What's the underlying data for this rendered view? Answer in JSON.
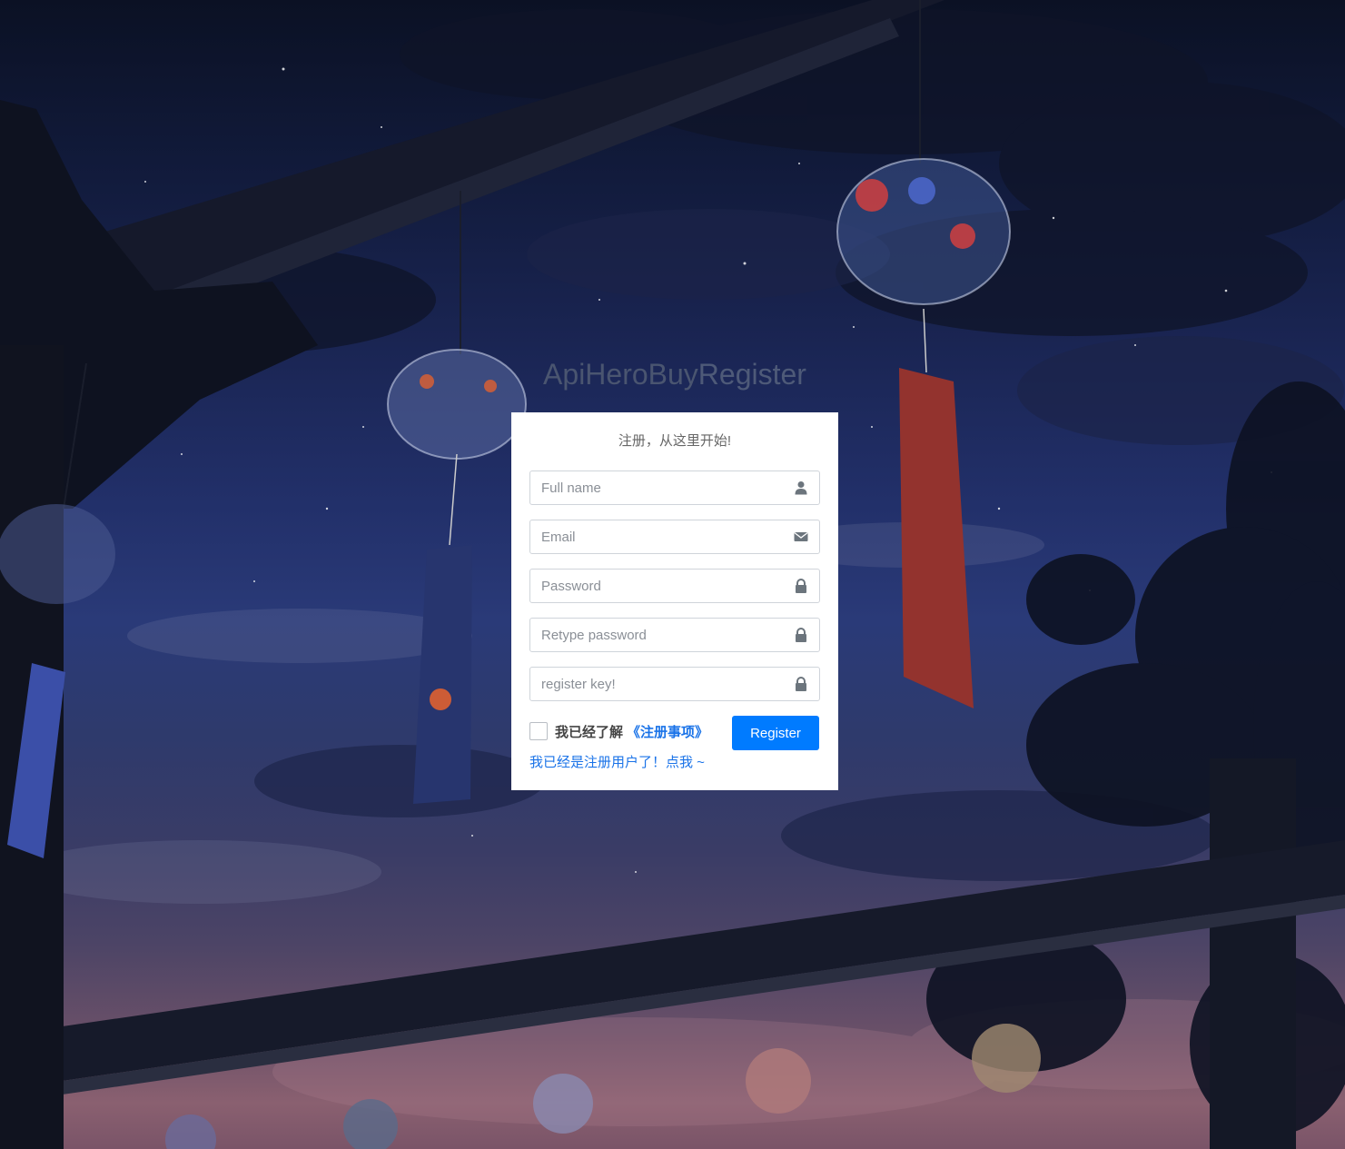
{
  "logo": {
    "strong": "ApiHeroBuy",
    "light": "Register"
  },
  "form": {
    "message": "注册，从这里开始!",
    "fields": [
      {
        "placeholder": "Full name",
        "icon": "user-icon"
      },
      {
        "placeholder": "Email",
        "icon": "envelope-icon"
      },
      {
        "placeholder": "Password",
        "icon": "lock-icon"
      },
      {
        "placeholder": "Retype password",
        "icon": "lock-icon"
      },
      {
        "placeholder": "register key!",
        "icon": "lock-icon"
      }
    ],
    "agree_text": "我已经了解",
    "agree_link": "《注册事项》",
    "agree_checked": false,
    "register_label": "Register",
    "login_link": "我已经是注册用户了！点我 ~"
  },
  "colors": {
    "primary": "#007bff",
    "link": "#1a73e8"
  }
}
